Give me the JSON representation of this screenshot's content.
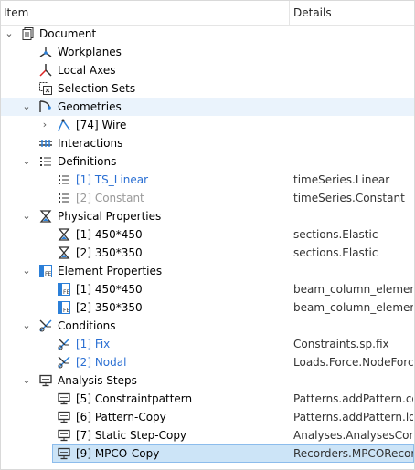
{
  "header": {
    "item": "Item",
    "details": "Details"
  },
  "rows": [
    {
      "label": "Document",
      "details": ""
    },
    {
      "label": "Workplanes",
      "details": ""
    },
    {
      "label": "Local Axes",
      "details": ""
    },
    {
      "label": "Selection Sets",
      "details": ""
    },
    {
      "label": "Geometries",
      "details": ""
    },
    {
      "label": "[74] Wire",
      "details": ""
    },
    {
      "label": "Interactions",
      "details": ""
    },
    {
      "label": "Definitions",
      "details": ""
    },
    {
      "label": "[1] TS_Linear",
      "details": "timeSeries.Linear"
    },
    {
      "label": "[2] Constant",
      "details": "timeSeries.Constant"
    },
    {
      "label": "Physical Properties",
      "details": ""
    },
    {
      "label": "[1] 450*450",
      "details": "sections.Elastic"
    },
    {
      "label": "[2] 350*350",
      "details": "sections.Elastic"
    },
    {
      "label": "Element Properties",
      "details": ""
    },
    {
      "label": "[1] 450*450",
      "details": "beam_column_elemen..."
    },
    {
      "label": "[2] 350*350",
      "details": "beam_column_elemen..."
    },
    {
      "label": "Conditions",
      "details": ""
    },
    {
      "label": "[1] Fix",
      "details": "Constraints.sp.fix"
    },
    {
      "label": "[2] Nodal",
      "details": "Loads.Force.NodeForce"
    },
    {
      "label": "Analysis Steps",
      "details": ""
    },
    {
      "label": "[5] Constraintpattern",
      "details": "Patterns.addPattern.co..."
    },
    {
      "label": "[6] Pattern-Copy",
      "details": "Patterns.addPattern.lo..."
    },
    {
      "label": "[7] Static Step-Copy",
      "details": "Analyses.AnalysesCom..."
    },
    {
      "label": "[9] MPCO-Copy",
      "details": "Recorders.MPCORecor..."
    }
  ],
  "icons": {
    "document": "document-icon",
    "workplanes": "workplanes-icon",
    "local_axes": "local-axes-icon",
    "selection_sets": "selection-sets-icon",
    "geometries": "geometries-icon",
    "wire": "wire-icon",
    "interactions": "interactions-icon",
    "definitions": "list-icon",
    "physical": "hourglass-icon",
    "element": "element-property-icon",
    "conditions": "conditions-icon",
    "analysis": "monitor-icon"
  },
  "colors": {
    "selected_row_bg": "#cce4f7",
    "selected_row_border": "#8cbcec",
    "highlight_row_bg": "#eaf3fc",
    "link_blue": "#2a6fd3",
    "disabled_gray": "#9a9a9a"
  }
}
